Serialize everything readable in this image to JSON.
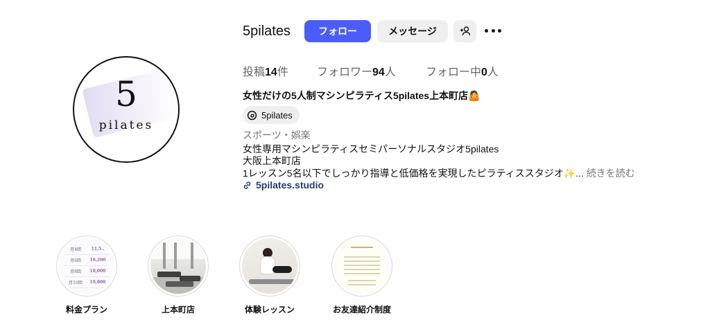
{
  "profile": {
    "username": "5pilates",
    "avatar_text": {
      "numeral": "5",
      "word": "pilates"
    }
  },
  "actions": {
    "follow_label": "フォロー",
    "message_label": "メッセージ",
    "add_user_icon": "person-plus-icon",
    "more_icon": "more-options-icon"
  },
  "stats": {
    "posts": {
      "label_before": "投稿",
      "value": "14",
      "label_after": "件"
    },
    "followers": {
      "label_before": "フォロワー",
      "value": "94",
      "label_after": "人"
    },
    "following": {
      "label_before": "フォロー中",
      "value": "0",
      "label_after": "人"
    }
  },
  "bio": {
    "name": "女性だけの5人制マシンピラティス5pilates上本町店🤷",
    "threads_handle": "5pilates",
    "category": "スポーツ・娯楽",
    "lines": [
      "女性専用マシンピラティスセミパーソナルスタジオ5pilates",
      "大阪上本町店",
      "1レッスン5名以下でしっかり指導と低価格を実現したピラティススタジオ✨..."
    ],
    "more_label": "続きを読む",
    "link": "5pilates.studio"
  },
  "highlights": [
    {
      "label": "料金プラン"
    },
    {
      "label": "上本町店"
    },
    {
      "label": "体験レッスン"
    },
    {
      "label": "お友達紹介制度"
    }
  ],
  "price_sheet": {
    "cells": [
      "月4回",
      "11,5..",
      "月6回",
      "16,200",
      "月8回",
      "18,000",
      "月10回",
      "19,800"
    ]
  },
  "colors": {
    "follow_button": "#4a5df9",
    "secondary_button": "#efefef",
    "link": "#233b6e",
    "muted_text": "#777777"
  }
}
